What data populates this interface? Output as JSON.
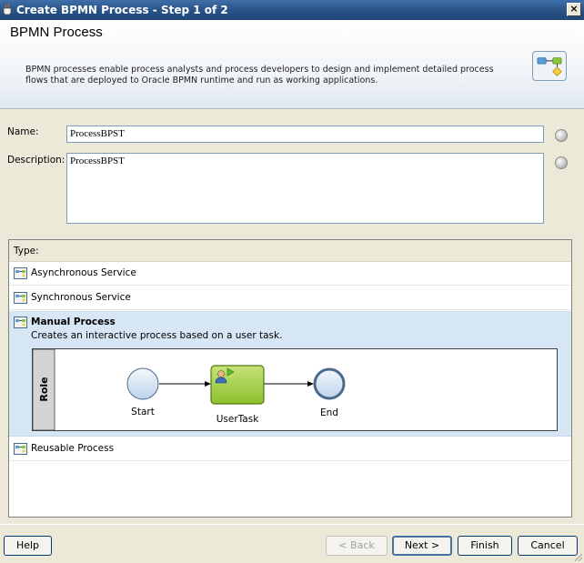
{
  "window": {
    "title": "Create BPMN Process - Step 1 of 2",
    "close_glyph": "×"
  },
  "header": {
    "title": "BPMN Process",
    "description": "BPMN processes enable process analysts and process developers to design and implement detailed process flows that are deployed to Oracle BPMN runtime and run as working applications."
  },
  "form": {
    "name_label": "Name:",
    "name_value": "ProcessBPST",
    "description_label": "Description:",
    "description_value": "ProcessBPST"
  },
  "types": {
    "header": "Type:",
    "items": [
      {
        "label": "Asynchronous Service"
      },
      {
        "label": "Synchronous Service"
      },
      {
        "label": "Manual Process",
        "description": "Creates an interactive process based on a user task.",
        "selected": true
      },
      {
        "label": "Reusable Process"
      }
    ],
    "diagram": {
      "lane": "Role",
      "start": "Start",
      "task": "UserTask",
      "end": "End"
    }
  },
  "buttons": {
    "help": "Help",
    "back": "< Back",
    "next": "Next >",
    "finish": "Finish",
    "cancel": "Cancel"
  },
  "colors": {
    "titlebar": "#2a5488",
    "selected_row": "#d6e6f5",
    "task_fill": "#9ccc3c",
    "event_fill": "#dce9f5"
  }
}
